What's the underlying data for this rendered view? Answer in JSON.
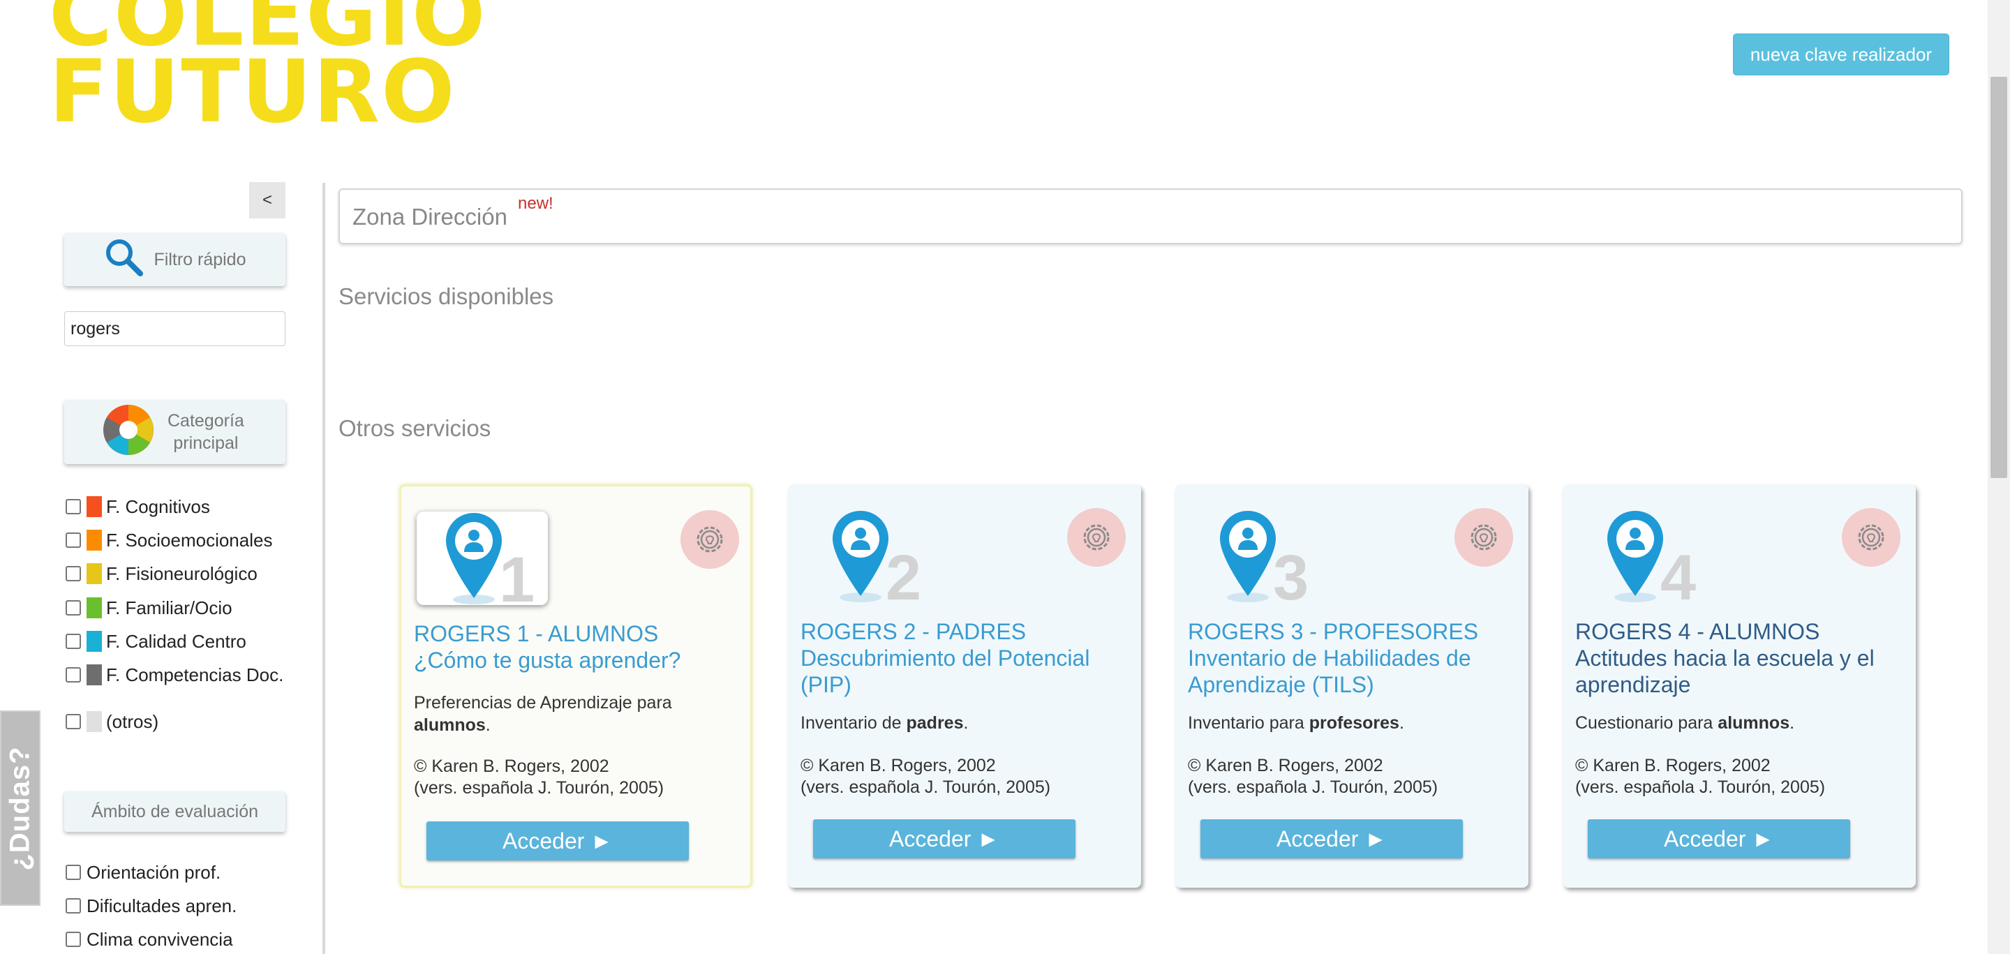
{
  "header": {
    "logo_line1": "COLEGIO",
    "logo_line2": "FUTURO",
    "nueva_clave_label": "nueva clave realizador"
  },
  "sidebar": {
    "collapse_label": "<",
    "filtro_label": "Filtro rápido",
    "search_value": "rogers",
    "categoria_label_1": "Categoría",
    "categoria_label_2": "principal",
    "categories": [
      {
        "label": "F. Cognitivos",
        "color": "#f4511e"
      },
      {
        "label": "F. Socioemocionales",
        "color": "#fb8c00"
      },
      {
        "label": "F. Fisioneurológico",
        "color": "#e6c619"
      },
      {
        "label": "F. Familiar/Ocio",
        "color": "#6abf2c"
      },
      {
        "label": "F. Calidad Centro",
        "color": "#1ab1d6"
      },
      {
        "label": "F. Competencias Doc.",
        "color": "#6e6e6e"
      },
      {
        "label": "(otros)",
        "color": "#e0e0e0"
      }
    ],
    "ambito_label": "Ámbito de evaluación",
    "ambitos": [
      "Orientación prof.",
      "Dificultades apren.",
      "Clima convivencia"
    ],
    "dudas_label": "¿Dudas?"
  },
  "main": {
    "zona_label": "Zona Dirección",
    "zona_badge": "new!",
    "servicios_disponibles": "Servicios disponibles",
    "otros_servicios": "Otros servicios",
    "cards": [
      {
        "number": "1",
        "title_1": "ROGERS 1 - ALUMNOS",
        "title_2": "¿Cómo te gusta aprender?",
        "desc_pre": "Preferencias de Aprendizaje para ",
        "desc_bold": "alumnos",
        "desc_post": ".",
        "copy_1": "© Karen B. Rogers, 2002",
        "copy_2": "(vers. española J. Tourón, 2005)",
        "button_label": "Acceder ►"
      },
      {
        "number": "2",
        "title_1": "ROGERS 2 - PADRES",
        "title_2": "Descubrimiento del Potencial (PIP)",
        "desc_pre": "Inventario de ",
        "desc_bold": "padres",
        "desc_post": ".",
        "copy_1": "© Karen B. Rogers, 2002",
        "copy_2": "(vers. española J. Tourón, 2005)",
        "button_label": "Acceder ►"
      },
      {
        "number": "3",
        "title_1": "ROGERS 3 - PROFESORES",
        "title_2": "Inventario de Habilidades de Aprendizaje (TILS)",
        "desc_pre": "Inventario para ",
        "desc_bold": "profesores",
        "desc_post": ".",
        "copy_1": "© Karen B. Rogers, 2002",
        "copy_2": "(vers. española J. Tourón, 2005)",
        "button_label": "Acceder ►"
      },
      {
        "number": "4",
        "title_1": "ROGERS 4 - ALUMNOS",
        "title_2": "Actitudes hacia la escuela y el aprendizaje",
        "desc_pre": "Cuestionario para ",
        "desc_bold": "alumnos",
        "desc_post": ".",
        "copy_1": "© Karen B. Rogers, 2002",
        "copy_2": "(vers. española J. Tourón, 2005)",
        "button_label": "Acceder ►"
      }
    ]
  },
  "colors": {
    "accent": "#5bc0de",
    "logo_yellow": "#f6dd1c",
    "card_title_blue": "#3a9bd0",
    "card_title_dark": "#2f5c86",
    "new_red": "#c9302c"
  }
}
